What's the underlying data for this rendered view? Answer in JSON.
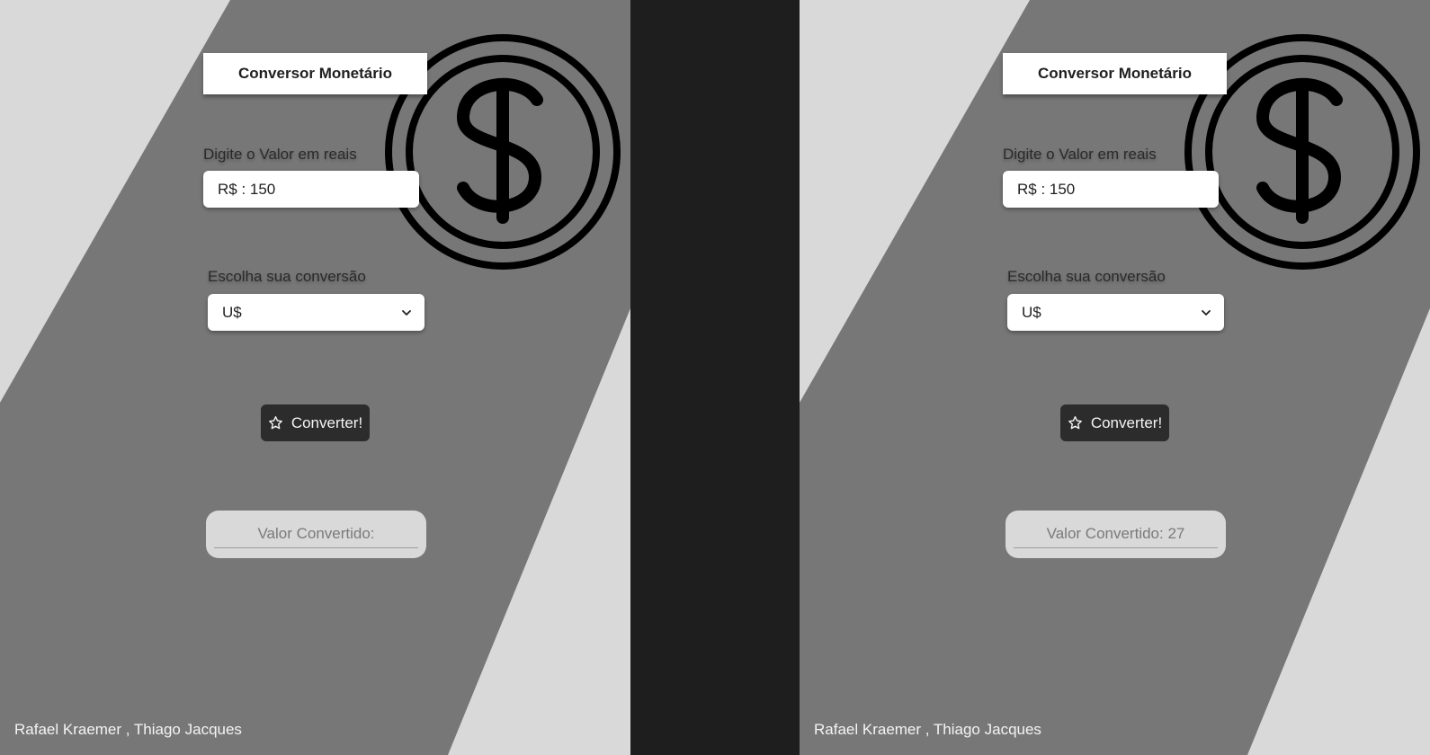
{
  "screens": [
    {
      "title": "Conversor Monetário",
      "amount_label": "Digite o Valor em reais",
      "amount_value": "R$ : 150",
      "conversion_label": "Escolha sua conversão",
      "conversion_selected": "U$",
      "convert_button": "Converter!",
      "result_text": "Valor Convertido:",
      "footer": "Rafael Kraemer , Thiago Jacques"
    },
    {
      "title": "Conversor Monetário",
      "amount_label": "Digite o Valor em reais",
      "amount_value": "R$ : 150",
      "conversion_label": "Escolha sua conversão",
      "conversion_selected": "U$",
      "convert_button": "Converter!",
      "result_text": "Valor Convertido: 27",
      "footer": "Rafael Kraemer , Thiago Jacques"
    }
  ],
  "icons": {
    "coin": "dollar-coin-icon",
    "button": "star-icon",
    "select": "chevron-down-icon"
  },
  "colors": {
    "background_dark": "#777777",
    "background_light": "#d9d9d9",
    "separator": "#1e1e1e",
    "button": "#2c2c2c"
  }
}
